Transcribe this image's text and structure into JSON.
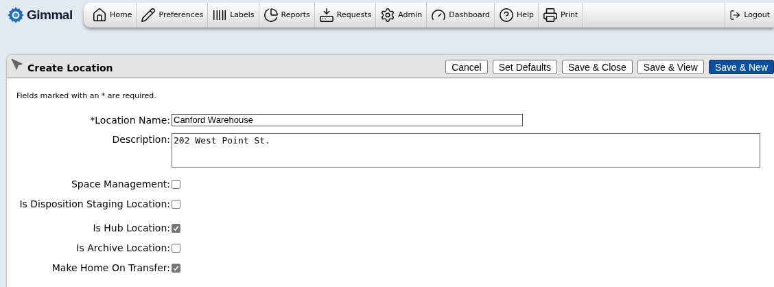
{
  "logo": {
    "text": "Gimmal"
  },
  "nav": [
    {
      "kind": "home",
      "label": "Home"
    },
    {
      "kind": "pencil",
      "label": "Preferences"
    },
    {
      "kind": "barcode",
      "label": "Labels"
    },
    {
      "kind": "pie",
      "label": "Reports"
    },
    {
      "kind": "tray",
      "label": "Requests"
    },
    {
      "kind": "gear",
      "label": "Admin"
    },
    {
      "kind": "gauge",
      "label": "Dashboard"
    },
    {
      "kind": "help",
      "label": "Help"
    },
    {
      "kind": "printer",
      "label": "Print"
    }
  ],
  "logout": {
    "label": "Logout"
  },
  "panel": {
    "title": "Create Location",
    "buttons": [
      {
        "label": "Cancel",
        "primary": false
      },
      {
        "label": "Set Defaults",
        "primary": false
      },
      {
        "label": "Save & Close",
        "primary": false
      },
      {
        "label": "Save & View",
        "primary": false
      },
      {
        "label": "Save & New",
        "primary": true
      }
    ],
    "note": "Fields marked with an * are required.",
    "fields": [
      {
        "kind": "text",
        "label": "*Location Name:",
        "value": "Canford Warehouse"
      },
      {
        "kind": "textarea",
        "label": "Description:",
        "value": "202 West Point St."
      }
    ],
    "checkboxes": [
      {
        "label": "Space Management:",
        "checked": false
      },
      {
        "label": "Is Disposition Staging Location:",
        "checked": false
      },
      {
        "label": "Is Hub Location:",
        "checked": true
      },
      {
        "label": "Is Archive Location:",
        "checked": false
      },
      {
        "label": "Make Home On Transfer:",
        "checked": true
      }
    ]
  }
}
